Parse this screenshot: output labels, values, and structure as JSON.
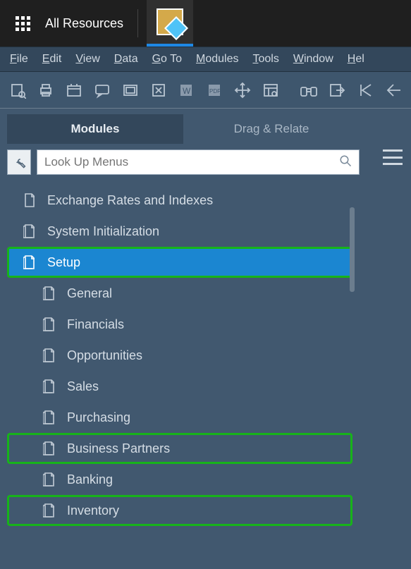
{
  "topbar": {
    "title": "All Resources"
  },
  "menubar": [
    {
      "u": "F",
      "rest": "ile"
    },
    {
      "u": "E",
      "rest": "dit"
    },
    {
      "u": "V",
      "rest": "iew"
    },
    {
      "u": "D",
      "rest": "ata"
    },
    {
      "u": "G",
      "rest": "o To"
    },
    {
      "u": "M",
      "rest": "odules"
    },
    {
      "u": "T",
      "rest": "ools"
    },
    {
      "u": "W",
      "rest": "indow"
    },
    {
      "u": "H",
      "rest": "el"
    }
  ],
  "tabs": {
    "modules": "Modules",
    "drag": "Drag & Relate"
  },
  "search": {
    "placeholder": "Look Up Menus"
  },
  "tree": [
    {
      "label": "Exchange Rates and Indexes",
      "depth": 0,
      "selected": false,
      "highlight": false,
      "icon": "doc"
    },
    {
      "label": "System Initialization",
      "depth": 0,
      "selected": false,
      "highlight": false,
      "icon": "folder"
    },
    {
      "label": "Setup",
      "depth": 0,
      "selected": true,
      "highlight": true,
      "icon": "folder"
    },
    {
      "label": "General",
      "depth": 1,
      "selected": false,
      "highlight": false,
      "icon": "folder"
    },
    {
      "label": "Financials",
      "depth": 1,
      "selected": false,
      "highlight": false,
      "icon": "folder"
    },
    {
      "label": "Opportunities",
      "depth": 1,
      "selected": false,
      "highlight": false,
      "icon": "folder"
    },
    {
      "label": "Sales",
      "depth": 1,
      "selected": false,
      "highlight": false,
      "icon": "folder"
    },
    {
      "label": "Purchasing",
      "depth": 1,
      "selected": false,
      "highlight": false,
      "icon": "folder"
    },
    {
      "label": "Business Partners",
      "depth": 1,
      "selected": false,
      "highlight": true,
      "icon": "folder"
    },
    {
      "label": "Banking",
      "depth": 1,
      "selected": false,
      "highlight": false,
      "icon": "folder"
    },
    {
      "label": "Inventory",
      "depth": 1,
      "selected": false,
      "highlight": true,
      "icon": "folder"
    }
  ]
}
